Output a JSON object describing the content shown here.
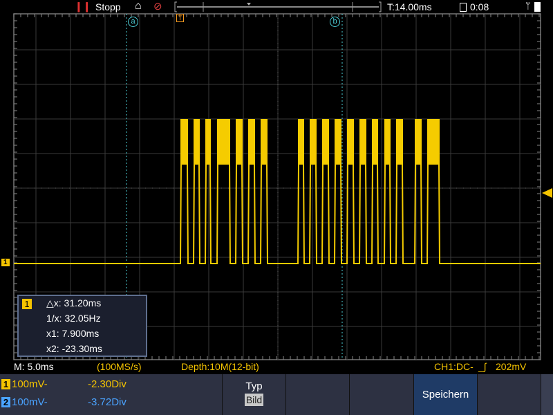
{
  "top": {
    "run_state": "Stopp",
    "trigger_time": "T:14.00ms",
    "timer": "0:08",
    "icons": [
      "pause-icon",
      "home-icon",
      "probe-icon",
      "lock-icon",
      "usb-icon",
      "battery-icon"
    ]
  },
  "cursors": {
    "a": "a",
    "b": "b",
    "trigger": "T"
  },
  "channel_marker": "1",
  "measure": {
    "channel": "1",
    "dx": "△x: 31.20ms",
    "inv": "1/x: 32.05Hz",
    "x1": "x1: 7.900ms",
    "x2": "x2: -23.30ms"
  },
  "status": {
    "timebase": "M: 5.0ms",
    "sample_rate": "(100MS/s)",
    "depth": "Depth:10M(12-bit)",
    "trigger": "CH1:DC-",
    "trigger_level": "202mV"
  },
  "channels": [
    {
      "num": "1",
      "scale": "100mV-",
      "offset": "-2.30Div",
      "color": "#f5c400"
    },
    {
      "num": "2",
      "scale": "100mV-",
      "offset": "-3.72Div",
      "color": "#4aa3ff"
    }
  ],
  "menu": {
    "type_label": "Typ",
    "type_value": "Bild",
    "save": "Speichern"
  }
}
